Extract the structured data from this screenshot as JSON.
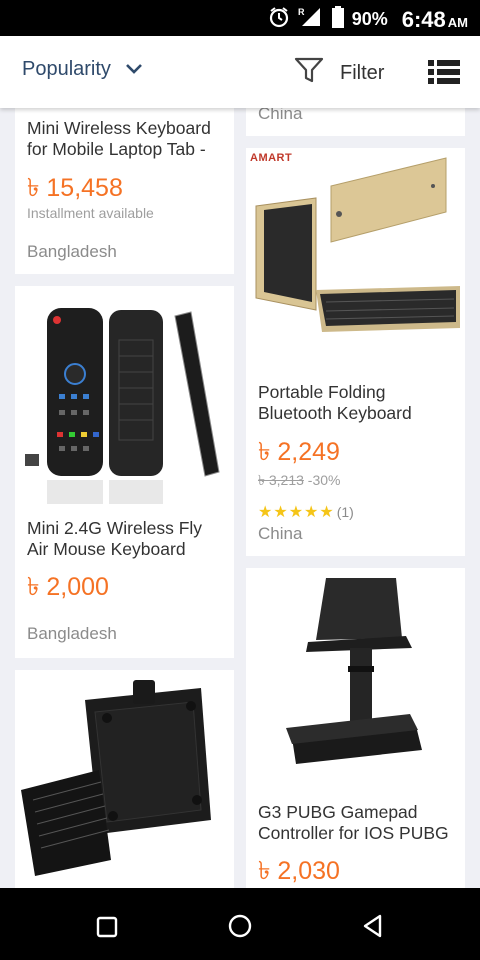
{
  "status": {
    "battery": "90%",
    "time": "6:48",
    "ampm": "AM",
    "network_badge": "R"
  },
  "toolbar": {
    "sort_label": "Popularity",
    "filter_label": "Filter"
  },
  "products": [
    {
      "title_l1": "Mini Wireless Keyboard",
      "title_l2": "for Mobile Laptop Tab -",
      "price": "৳ 15,458",
      "installment": "Installment available",
      "location": "Bangladesh"
    },
    {
      "location": "China"
    },
    {
      "brand": "AMART",
      "title_l1": "Portable Folding",
      "title_l2": "Bluetooth Keyboard",
      "price": "৳ 2,249",
      "old_price": "৳ 3,213",
      "discount": "-30%",
      "rating_count": "(1)",
      "location": "China"
    },
    {
      "title_l1": "Mini 2.4G Wireless Fly",
      "title_l2": "Air Mouse Keyboard",
      "price": "৳ 2,000",
      "location": "Bangladesh"
    },
    {
      "title_l1": "G3 PUBG Gamepad",
      "title_l2": "Controller for IOS PUBG",
      "price": "৳ 2,030"
    }
  ],
  "icons": {
    "sort": "chevron-down-icon",
    "filter": "funnel-icon",
    "view": "list-view-icon",
    "alarm": "alarm-icon",
    "signal": "signal-icon",
    "battery": "battery-icon",
    "back": "back-triangle-icon",
    "home": "home-circle-icon",
    "recents": "recents-square-icon"
  },
  "colors": {
    "price": "#f57224",
    "sort_text": "#2f4a6b",
    "star": "#f5c518"
  }
}
